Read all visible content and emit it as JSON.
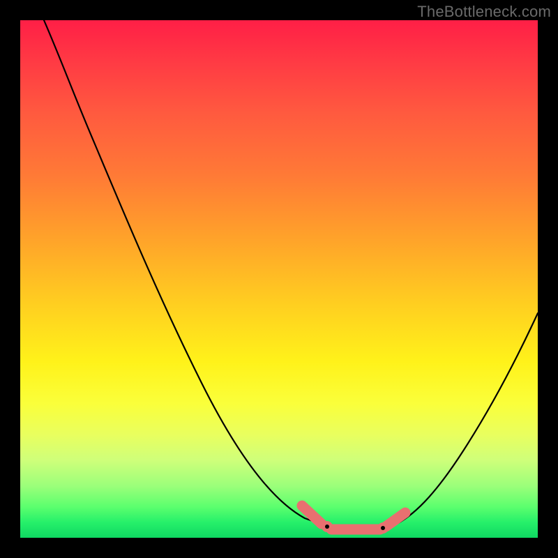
{
  "watermark": "TheBottleneck.com",
  "chart_data": {
    "type": "line",
    "title": "",
    "xlabel": "",
    "ylabel": "",
    "xlim": [
      0,
      100
    ],
    "ylim": [
      0,
      100
    ],
    "grid": false,
    "background_gradient": {
      "top": "#ff1f46",
      "mid": "#fff21a",
      "bottom": "#0fd862",
      "meaning": "red high value to green low value"
    },
    "series": [
      {
        "name": "bottleneck-curve",
        "x": [
          0,
          6,
          12,
          18,
          24,
          30,
          36,
          42,
          48,
          54,
          58,
          62,
          66,
          70,
          74,
          78,
          84,
          90,
          96,
          100
        ],
        "y": [
          100,
          92,
          83,
          74,
          65,
          56,
          47,
          38,
          28,
          17,
          10,
          3,
          0,
          0,
          2,
          7,
          16,
          27,
          40,
          50
        ],
        "stroke": "#000000"
      }
    ],
    "highlight": {
      "name": "optimal-flat-segment",
      "x_range": [
        58,
        74
      ],
      "y": 0,
      "stroke": "#e87070",
      "markers": [
        {
          "x": 60,
          "y": 2
        },
        {
          "x": 72,
          "y": 2
        }
      ]
    }
  }
}
